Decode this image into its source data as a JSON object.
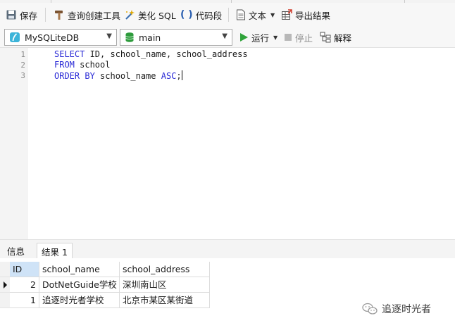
{
  "toolbar": {
    "save": "保存",
    "query_builder": "查询创建工具",
    "beautify_sql": "美化 SQL",
    "code_snippet": "代码段",
    "text": "文本",
    "export": "导出结果"
  },
  "connection": {
    "selected": "MySQLiteDB"
  },
  "database": {
    "selected": "main"
  },
  "run": {
    "run_label": "运行",
    "stop_label": "停止",
    "explain_label": "解释"
  },
  "editor": {
    "lines": [
      {
        "num": "1",
        "kw": "SELECT",
        "rest": " ID, school_name, school_address",
        "kw2": "",
        "rest2": ""
      },
      {
        "num": "2",
        "kw": "FROM",
        "rest": " school",
        "kw2": "",
        "rest2": ""
      },
      {
        "num": "3",
        "kw": "ORDER BY",
        "rest": " school_name ",
        "kw2": "ASC",
        "rest2": ";"
      }
    ]
  },
  "results": {
    "tabs": [
      {
        "label": "信息"
      },
      {
        "label": "结果 1"
      }
    ],
    "active_tab": "结果 1",
    "columns": [
      "ID",
      "school_name",
      "school_address"
    ],
    "rows": [
      [
        "2",
        "DotNetGuide学校",
        "深圳南山区"
      ],
      [
        "1",
        "追逐时光者学校",
        "北京市某区某街道"
      ]
    ]
  },
  "watermark": {
    "text": "追逐时光者"
  },
  "colors": {
    "keyword": "#2a2ad6",
    "selected_header": "#cfe3f7",
    "run_green": "#2fa33a",
    "db_green": "#2e9b3c"
  }
}
